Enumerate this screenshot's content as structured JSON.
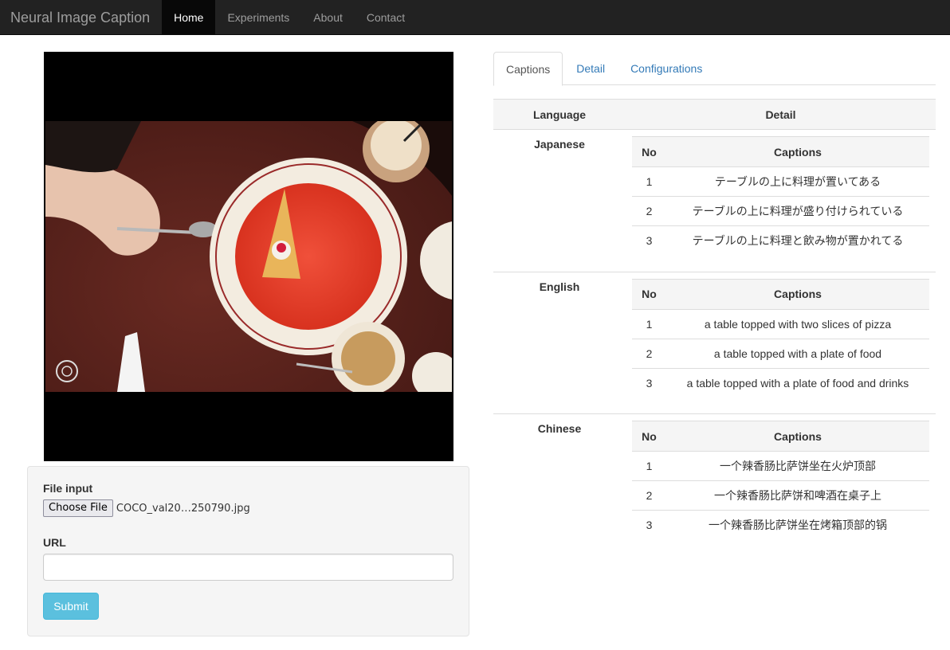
{
  "navbar": {
    "brand": "Neural Image Caption",
    "items": [
      {
        "label": "Home",
        "active": true
      },
      {
        "label": "Experiments"
      },
      {
        "label": "About"
      },
      {
        "label": "Contact"
      }
    ]
  },
  "form": {
    "file_label": "File input",
    "choose_button": "Choose File",
    "file_name": "COCO_val20…250790.jpg",
    "url_label": "URL",
    "url_value": "",
    "submit": "Submit"
  },
  "tabs": [
    {
      "label": "Captions",
      "active": true
    },
    {
      "label": "Detail"
    },
    {
      "label": "Configurations"
    }
  ],
  "table": {
    "headers": {
      "language": "Language",
      "detail": "Detail"
    },
    "sub_headers": {
      "no": "No",
      "captions": "Captions"
    },
    "rows": [
      {
        "language": "Japanese",
        "captions": [
          {
            "no": "1",
            "text": "テーブルの上に料理が置いてある"
          },
          {
            "no": "2",
            "text": "テーブルの上に料理が盛り付けられている"
          },
          {
            "no": "3",
            "text": "テーブルの上に料理と飲み物が置かれてる"
          }
        ]
      },
      {
        "language": "English",
        "captions": [
          {
            "no": "1",
            "text": "a table topped with two slices of pizza"
          },
          {
            "no": "2",
            "text": "a table topped with a plate of food"
          },
          {
            "no": "3",
            "text": "a table topped with a plate of food and drinks"
          }
        ]
      },
      {
        "language": "Chinese",
        "captions": [
          {
            "no": "1",
            "text": "一个辣香肠比萨饼坐在火炉顶部"
          },
          {
            "no": "2",
            "text": "一个辣香肠比萨饼和啤酒在桌子上"
          },
          {
            "no": "3",
            "text": "一个辣香肠比萨饼坐在烤箱顶部的锅"
          }
        ]
      }
    ]
  }
}
